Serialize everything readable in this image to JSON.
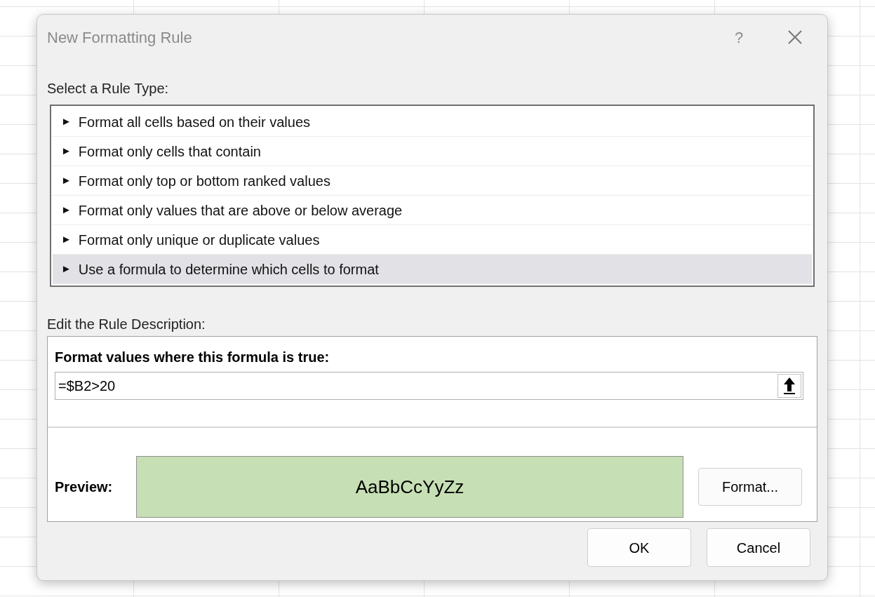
{
  "window": {
    "title": "New Formatting Rule",
    "help": "?"
  },
  "rule_type": {
    "label": "Select a Rule Type:",
    "items": [
      {
        "arrow": "►",
        "label": "Format all cells based on their values",
        "selected": false
      },
      {
        "arrow": "►",
        "label": "Format only cells that contain",
        "selected": false
      },
      {
        "arrow": "►",
        "label": "Format only top or bottom ranked values",
        "selected": false
      },
      {
        "arrow": "►",
        "label": "Format only values that are above or below average",
        "selected": false
      },
      {
        "arrow": "►",
        "label": "Format only unique or duplicate values",
        "selected": false
      },
      {
        "arrow": "►",
        "label": "Use a formula to determine which cells to format",
        "selected": true
      }
    ]
  },
  "description": {
    "label": "Edit the Rule Description:",
    "formula_label": "Format values where this formula is true:",
    "formula": "=$B2>20",
    "preview_label": "Preview:",
    "preview_text": "AaBbCcYyZz",
    "format_button": "Format..."
  },
  "buttons": [
    "OK",
    "Cancel"
  ]
}
